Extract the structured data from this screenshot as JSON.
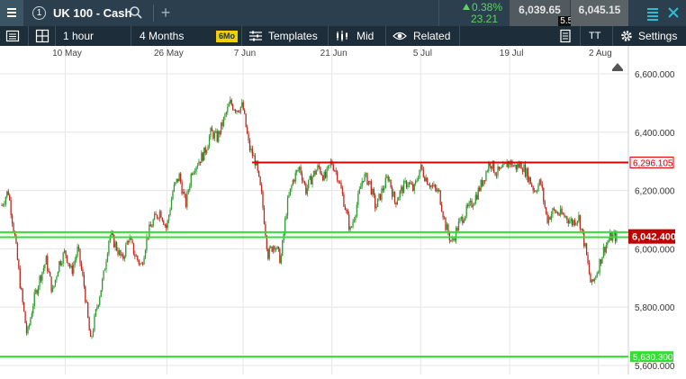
{
  "instrument": {
    "title": "UK 100 - Cash",
    "tab_number": "1"
  },
  "quote": {
    "change_percent": "0.38%",
    "change_points": "23.21",
    "sell": "6,039.65",
    "spread": "5.50",
    "buy": "6,045.15"
  },
  "toolbar": {
    "interval": "1 hour",
    "range": "4 Months",
    "badge": "6Mo",
    "templates": "Templates",
    "price_type": "Mid",
    "related": "Related",
    "settings": "Settings",
    "text_tool": "TT"
  },
  "colors": {
    "up": "#2e9b2e",
    "down": "#c0281e",
    "resistance": "#dd0000",
    "support": "#33dd33",
    "current_price": "#c00000",
    "topbar": "#2b3f4e",
    "toolbar": "#1d2d39"
  },
  "icons": [
    "menu-icon",
    "search-icon",
    "plus-icon",
    "triangle-up-icon",
    "collapse-icon",
    "close-icon",
    "panel-icon",
    "layout-icon",
    "templates-icon",
    "candles-icon",
    "eye-icon",
    "document-icon",
    "gear-icon",
    "home-icon"
  ],
  "chart_data": {
    "type": "candlestick",
    "x_tick_labels": [
      "10 May",
      "26 May",
      "7 Jun",
      "21 Jun",
      "5 Jul",
      "19 Jul",
      "2 Aug"
    ],
    "y_tick_labels": [
      "6,600.000",
      "6,400.000",
      "6,200.000",
      "6,000.000",
      "5,800.000",
      "5,600.000"
    ],
    "y_ticks": [
      6600,
      6400,
      6200,
      6000,
      5800,
      5600
    ],
    "ylim": [
      5580,
      6700
    ],
    "resistance_line": {
      "label": "6,296.105",
      "value": 6296.105
    },
    "current_price": {
      "label": "6,042.400",
      "value": 6042.4
    },
    "support_lines": [
      {
        "label": "",
        "value": 6057
      },
      {
        "label": "",
        "value": 6040
      },
      {
        "label": "5,630.300",
        "value": 5630.3
      }
    ],
    "price_path": [
      [
        "30 Apr",
        6150
      ],
      [
        "1 May",
        6200
      ],
      [
        "2 May",
        6050
      ],
      [
        "3 May",
        5860
      ],
      [
        "4 May",
        5700
      ],
      [
        "5 May",
        5820
      ],
      [
        "6 May",
        5900
      ],
      [
        "7 May",
        5960
      ],
      [
        "8 May",
        5850
      ],
      [
        "9 May",
        5950
      ],
      [
        "10 May",
        5990
      ],
      [
        "11 May",
        5920
      ],
      [
        "12 May",
        6000
      ],
      [
        "13 May",
        5870
      ],
      [
        "14 May",
        5680
      ],
      [
        "15 May",
        5800
      ],
      [
        "16 May",
        5900
      ],
      [
        "17 May",
        6050
      ],
      [
        "18 May",
        6010
      ],
      [
        "19 May",
        5960
      ],
      [
        "20 May",
        6040
      ],
      [
        "21 May",
        5980
      ],
      [
        "22 May",
        5940
      ],
      [
        "23 May",
        6050
      ],
      [
        "24 May",
        6100
      ],
      [
        "25 May",
        6130
      ],
      [
        "26 May",
        6070
      ],
      [
        "27 May",
        6200
      ],
      [
        "28 May",
        6250
      ],
      [
        "29 May",
        6150
      ],
      [
        "30 May",
        6270
      ],
      [
        "31 May",
        6300
      ],
      [
        "1 Jun",
        6330
      ],
      [
        "2 Jun",
        6400
      ],
      [
        "3 Jun",
        6380
      ],
      [
        "4 Jun",
        6440
      ],
      [
        "5 Jun",
        6500
      ],
      [
        "6 Jun",
        6480
      ],
      [
        "7 Jun",
        6490
      ],
      [
        "8 Jun",
        6350
      ],
      [
        "9 Jun",
        6300
      ],
      [
        "10 Jun",
        6180
      ],
      [
        "11 Jun",
        5980
      ],
      [
        "12 Jun",
        6020
      ],
      [
        "13 Jun",
        5960
      ],
      [
        "14 Jun",
        6150
      ],
      [
        "15 Jun",
        6240
      ],
      [
        "16 Jun",
        6280
      ],
      [
        "17 Jun",
        6200
      ],
      [
        "18 Jun",
        6250
      ],
      [
        "19 Jun",
        6280
      ],
      [
        "20 Jun",
        6240
      ],
      [
        "21 Jun",
        6300
      ],
      [
        "22 Jun",
        6250
      ],
      [
        "23 Jun",
        6160
      ],
      [
        "24 Jun",
        6060
      ],
      [
        "25 Jun",
        6150
      ],
      [
        "26 Jun",
        6250
      ],
      [
        "27 Jun",
        6230
      ],
      [
        "28 Jun",
        6140
      ],
      [
        "29 Jun",
        6200
      ],
      [
        "30 Jun",
        6250
      ],
      [
        "1 Jul",
        6160
      ],
      [
        "2 Jul",
        6200
      ],
      [
        "3 Jul",
        6230
      ],
      [
        "4 Jul",
        6200
      ],
      [
        "5 Jul",
        6280
      ],
      [
        "6 Jul",
        6240
      ],
      [
        "7 Jul",
        6210
      ],
      [
        "8 Jul",
        6190
      ],
      [
        "9 Jul",
        6080
      ],
      [
        "10 Jul",
        6020
      ],
      [
        "11 Jul",
        6080
      ],
      [
        "12 Jul",
        6120
      ],
      [
        "13 Jul",
        6150
      ],
      [
        "14 Jul",
        6190
      ],
      [
        "15 Jul",
        6240
      ],
      [
        "16 Jul",
        6300
      ],
      [
        "17 Jul",
        6260
      ],
      [
        "18 Jul",
        6270
      ],
      [
        "19 Jul",
        6300
      ],
      [
        "20 Jul",
        6280
      ],
      [
        "21 Jul",
        6290
      ],
      [
        "22 Jul",
        6250
      ],
      [
        "23 Jul",
        6200
      ],
      [
        "24 Jul",
        6230
      ],
      [
        "25 Jul",
        6100
      ],
      [
        "26 Jul",
        6130
      ],
      [
        "27 Jul",
        6120
      ],
      [
        "28 Jul",
        6110
      ],
      [
        "29 Jul",
        6090
      ],
      [
        "30 Jul",
        6110
      ],
      [
        "31 Jul",
        6010
      ],
      [
        "1 Aug",
        5870
      ],
      [
        "2 Aug",
        5930
      ],
      [
        "3 Aug",
        6000
      ],
      [
        "4 Aug",
        6040
      ],
      [
        "5 Aug",
        6042
      ]
    ]
  }
}
